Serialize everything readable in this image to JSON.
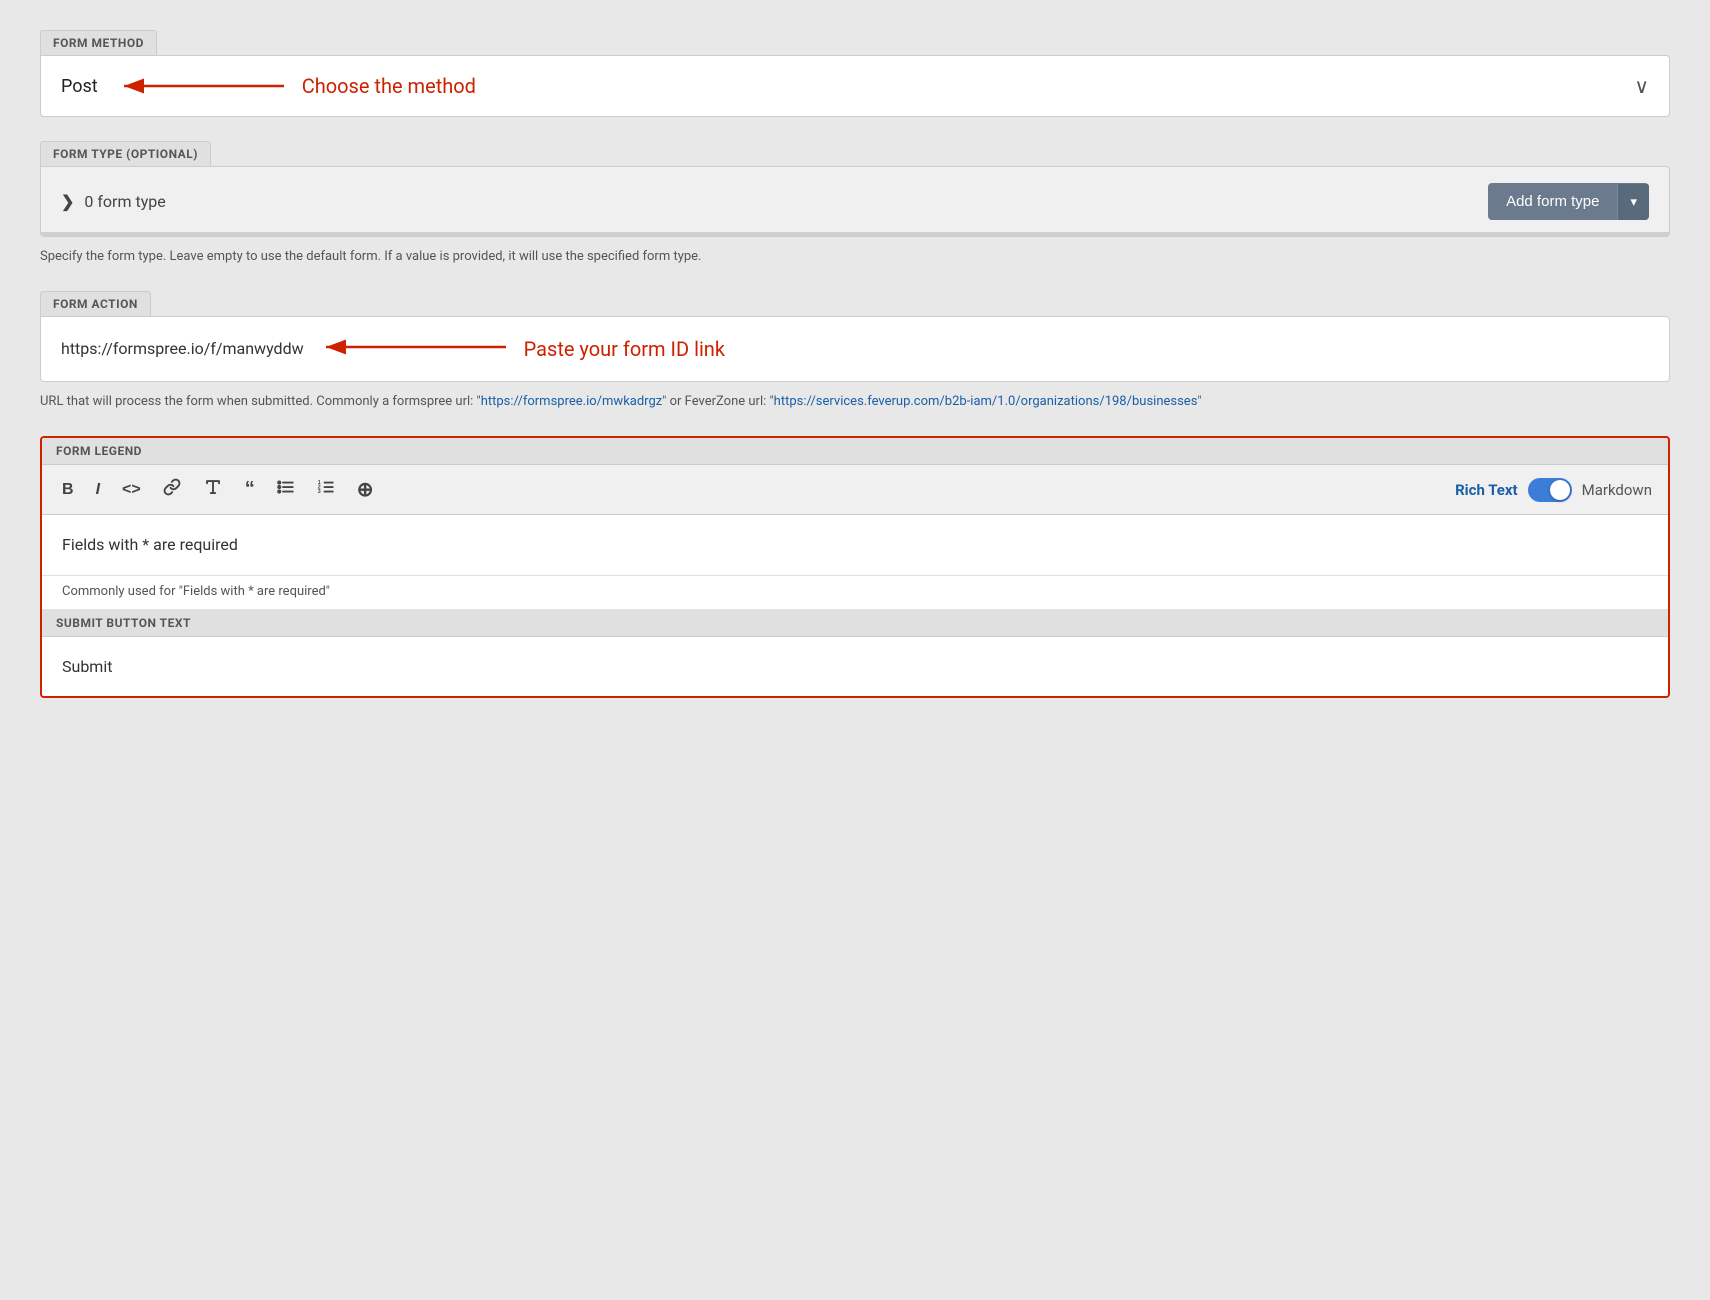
{
  "form_method": {
    "section_label": "FORM METHOD",
    "value": "Post",
    "annotation": "Choose the method",
    "chevron": "⌄"
  },
  "form_type": {
    "section_label": "FORM TYPE (OPTIONAL)",
    "count_label": "0 form type",
    "add_button_label": "Add form type",
    "add_button_arrow": "▾",
    "hint": "Specify the form type. Leave empty to use the default form. If a value is provided, it will use the specified form type."
  },
  "form_action": {
    "section_label": "FORM ACTION",
    "url_value": "https://formspree.io/f/manwyddw",
    "annotation": "Paste your form ID link",
    "hint_prefix": "URL that will process the form when submitted. Commonly a formspree url: \"",
    "hint_link1": "https://formspree.io/mwkadrgz",
    "hint_mid": "\" or FeverZone url: \"",
    "hint_link2": "https://services.feverup.com/b2b-iam/1.0/organizations/198/businesses",
    "hint_suffix": "\""
  },
  "form_legend": {
    "section_label": "FORM LEGEND",
    "toolbar": {
      "bold": "B",
      "italic": "I",
      "code": "<>",
      "link": "🔗",
      "heading": "H↓",
      "quote": "❝",
      "bullet": "≡",
      "ordered": "1≡",
      "insert": "⊕"
    },
    "rich_text_label": "Rich Text",
    "markdown_label": "Markdown",
    "content": "Fields with * are required",
    "hint": "Commonly used for \"Fields with * are required\""
  },
  "submit_button": {
    "section_label": "SUBMIT BUTTON TEXT",
    "value": "Submit"
  }
}
